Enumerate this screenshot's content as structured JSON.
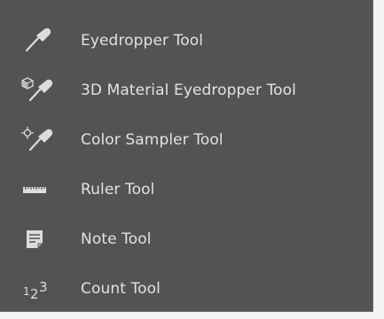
{
  "menu": {
    "items": [
      {
        "label": "Eyedropper Tool",
        "icon": "eyedropper-icon"
      },
      {
        "label": "3D Material Eyedropper Tool",
        "icon": "3d-material-eyedropper-icon"
      },
      {
        "label": "Color Sampler Tool",
        "icon": "color-sampler-icon"
      },
      {
        "label": "Ruler Tool",
        "icon": "ruler-icon"
      },
      {
        "label": "Note Tool",
        "icon": "note-icon"
      },
      {
        "label": "Count Tool",
        "icon": "count-icon"
      }
    ]
  },
  "colors": {
    "panel_background": "#535353",
    "text": "#e2e2e2",
    "icon": "#dcdcdc"
  },
  "count_icon_glyphs": {
    "first": "1",
    "second": "2",
    "third": "3"
  }
}
